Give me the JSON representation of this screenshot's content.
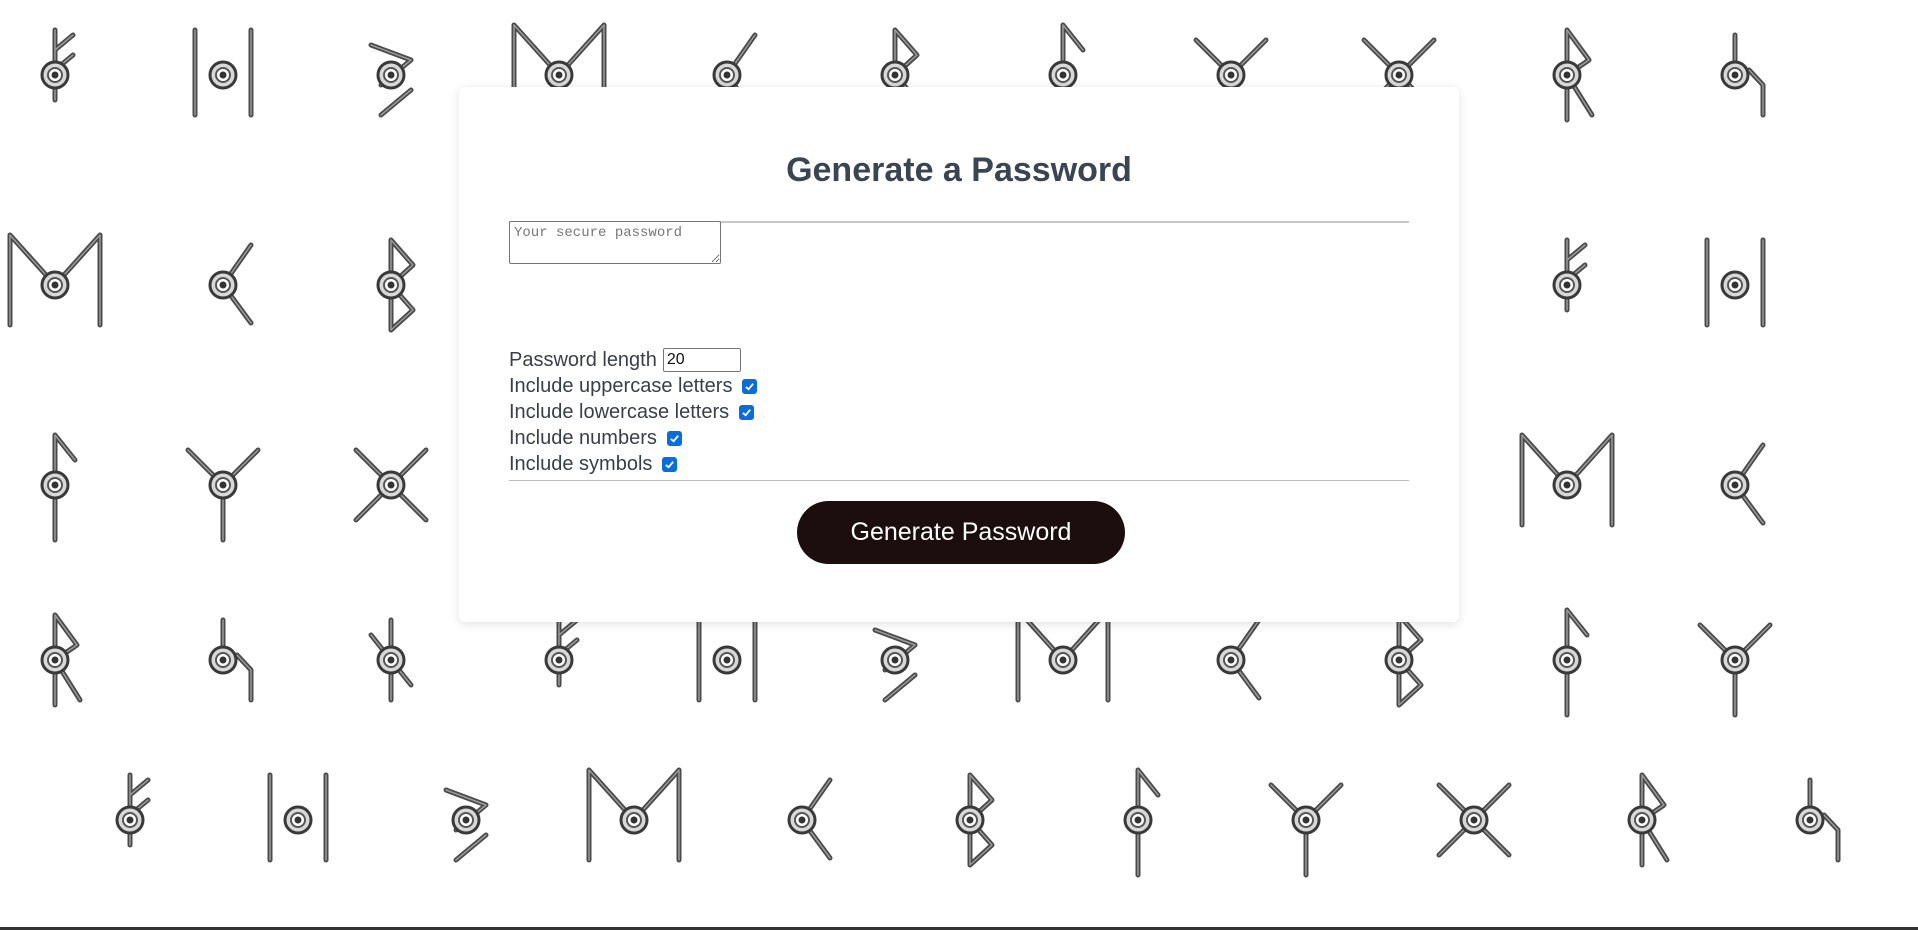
{
  "card": {
    "title": "Generate a Password",
    "output_placeholder": "Your secure password",
    "output_value": "",
    "settings": {
      "length_label": "Password length",
      "length_value": "20",
      "uppercase_label": "Include uppercase letters",
      "uppercase_checked": true,
      "lowercase_label": "Include lowercase letters",
      "lowercase_checked": true,
      "numbers_label": "Include numbers",
      "numbers_checked": true,
      "symbols_label": "Include symbols",
      "symbols_checked": true
    },
    "generate_button_label": "Generate Password"
  },
  "background": {
    "pattern_icon": "unown-glyph-icon"
  },
  "colors": {
    "title": "#3b4552",
    "button_bg": "#1c0e0e",
    "checkbox": "#0b6cde"
  }
}
